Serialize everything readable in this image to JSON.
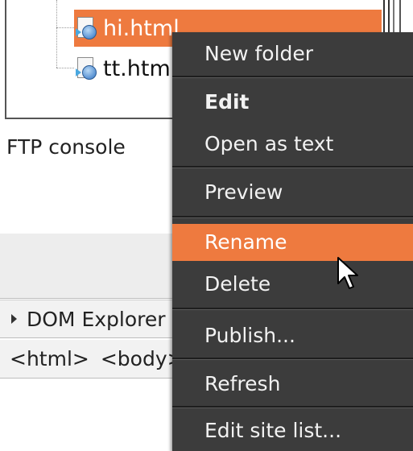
{
  "file_tree": {
    "items": [
      {
        "label": "hi.html",
        "icon": "html-file-icon",
        "selected": true
      },
      {
        "label": "tt.html",
        "icon": "html-file-icon",
        "selected": false
      }
    ]
  },
  "panels": {
    "ftp_console_label": "FTP console",
    "dom_explorer_label": "DOM Explorer",
    "breadcrumb": [
      "<html>",
      "<body>"
    ]
  },
  "context_menu": {
    "items": [
      {
        "label": "New folder"
      },
      {
        "label": "Edit",
        "bold": true
      },
      {
        "label": "Open as text"
      },
      {
        "label": "Preview"
      },
      {
        "label": "Rename",
        "highlighted": true
      },
      {
        "label": "Delete"
      },
      {
        "label": "Publish..."
      },
      {
        "label": "Refresh"
      },
      {
        "label": "Edit site list..."
      }
    ]
  },
  "colors": {
    "selection": "#ee7a3f",
    "menu_background": "#3c3c3c",
    "menu_text": "#f2f2f2"
  }
}
